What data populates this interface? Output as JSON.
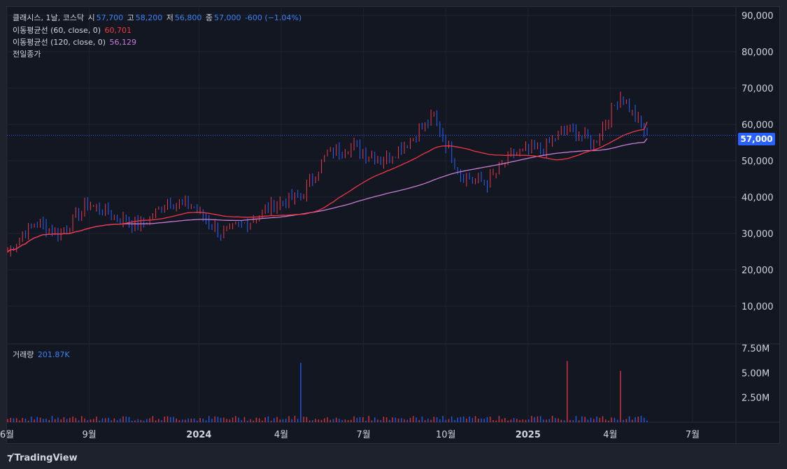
{
  "legend": {
    "symbol": "클래시스, 1날, 코스닥",
    "open_label": "시",
    "open": "57,700",
    "high_label": "고",
    "high": "58,200",
    "low_label": "저",
    "low": "56,800",
    "close_label": "종",
    "close": "57,000",
    "change": "-600 (−1.04%)",
    "ma60_label": "이동평균선 (60, close, 0)",
    "ma60_value": "60,701",
    "ma120_label": "이동평균선 (120, close, 0)",
    "ma120_value": "56,129",
    "prev_close_label": "전일종가",
    "volume_label": "거래량",
    "volume_value": "201.87K"
  },
  "last_price_tag": "57,000",
  "branding": {
    "name": "TradingView",
    "logo_icon": "tradingview-logo-icon"
  },
  "colors": {
    "up": "#f23645",
    "down": "#2962ff",
    "ma60": "#f23645",
    "ma120": "#c77dd6",
    "background": "#131722"
  },
  "chart_data": [
    {
      "type": "line",
      "subtype": "candlestick",
      "price_axis": {
        "ylim": [
          0,
          90000
        ],
        "ticks": [
          "10,000",
          "20,000",
          "30,000",
          "40,000",
          "50,000",
          "60,000",
          "70,000",
          "80,000",
          "90,000"
        ]
      },
      "time_axis": {
        "ticks": [
          "6월",
          "9월",
          "2024",
          "4월",
          "7월",
          "10월",
          "2025",
          "4월",
          "7월"
        ]
      },
      "last_price": 57000,
      "price_anchors": [
        {
          "date": "2023-06",
          "price": 25000
        },
        {
          "date": "2023-07",
          "price": 33000
        },
        {
          "date": "2023-08",
          "price": 30000
        },
        {
          "date": "2023-09",
          "price": 38000
        },
        {
          "date": "2023-10",
          "price": 35000
        },
        {
          "date": "2023-11",
          "price": 32000
        },
        {
          "date": "2023-12",
          "price": 39000
        },
        {
          "date": "2024-01",
          "price": 37000
        },
        {
          "date": "2024-02",
          "price": 30000
        },
        {
          "date": "2024-03",
          "price": 33000
        },
        {
          "date": "2024-04",
          "price": 38000
        },
        {
          "date": "2024-05",
          "price": 40000
        },
        {
          "date": "2024-06",
          "price": 52000
        },
        {
          "date": "2024-07",
          "price": 54000
        },
        {
          "date": "2024-08",
          "price": 50000
        },
        {
          "date": "2024-09",
          "price": 55000
        },
        {
          "date": "2024-10",
          "price": 62000
        },
        {
          "date": "2024-11",
          "price": 46000
        },
        {
          "date": "2024-12",
          "price": 44000
        },
        {
          "date": "2025-01",
          "price": 52000
        },
        {
          "date": "2025-02",
          "price": 53000
        },
        {
          "date": "2025-03",
          "price": 59000
        },
        {
          "date": "2025-04",
          "price": 55000
        },
        {
          "date": "2025-05",
          "price": 68000
        },
        {
          "date": "2025-06",
          "price": 57000
        }
      ],
      "series": [
        {
          "name": "이동평균선 (60, close, 0)",
          "last": 60701
        },
        {
          "name": "이동평균선 (120, close, 0)",
          "last": 56129
        }
      ]
    },
    {
      "type": "bar",
      "subtype": "volume",
      "ylim": [
        0,
        7500000
      ],
      "ticks": [
        "2.50M",
        "5.00M",
        "7.50M"
      ],
      "last_volume": 201870,
      "spikes": [
        {
          "date": "2024-05",
          "value": 6000000
        },
        {
          "date": "2025-03",
          "value": 6200000
        },
        {
          "date": "2025-05",
          "value": 5200000
        }
      ]
    }
  ]
}
